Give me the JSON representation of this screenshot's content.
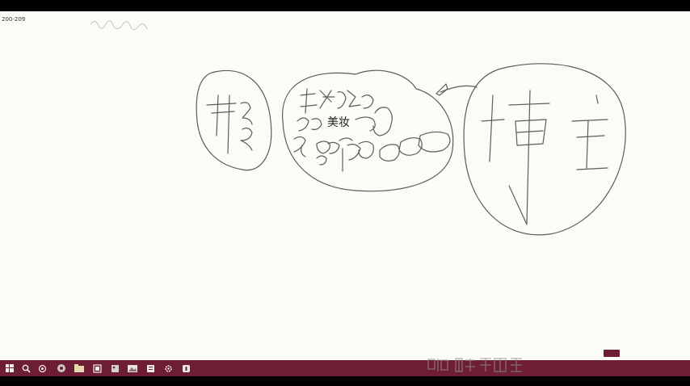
{
  "corner_label": "200-209",
  "center_label": "美妆",
  "tray": {
    "badge": "",
    "time": "",
    "date": ""
  },
  "taskbar": {
    "icons": [
      "windows-start-icon",
      "search-icon",
      "task-view-icon",
      "browser-icon",
      "file-explorer-icon",
      "media-icon",
      "photos-icon",
      "image-icon",
      "settings-icon",
      "app-icon"
    ]
  },
  "colors": {
    "canvas": "#fbfbf8",
    "ink": "#5a5a5a",
    "taskbar": "#6e1e34",
    "frame": "#000000"
  }
}
